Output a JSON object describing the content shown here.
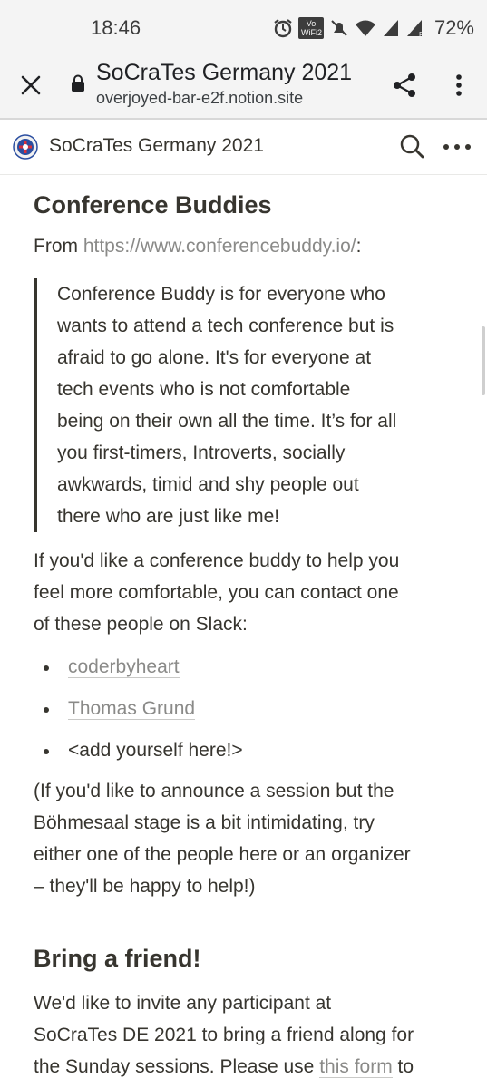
{
  "status_bar": {
    "time": "18:46",
    "wifi_badge": "Vo WiFi2",
    "battery": "72%"
  },
  "browser": {
    "page_title": "SoCraTes Germany 2021",
    "domain": "overjoyed-bar-e2f.notion.site"
  },
  "notion_bar": {
    "title": "SoCraTes Germany 2021"
  },
  "content": {
    "section1_heading": "Conference Buddies",
    "from_prefix": "From ",
    "from_link": "https://www.conferencebuddy.io/",
    "from_suffix": ":",
    "quote_lines": [
      "Conference Buddy is for everyone who",
      "wants to attend a tech conference but is",
      "afraid to go alone. It's for everyone at",
      "tech events who is not comfortable",
      "being on their own all the time. It’s for all",
      "you first-timers, Introverts, socially",
      "awkwards, timid and shy people out",
      "there who are just like me!"
    ],
    "contact_lines": [
      "If you'd like a conference buddy to help you",
      "feel more comfortable, you can contact one",
      "of these people on Slack:"
    ],
    "buddies": [
      "coderbyheart",
      "Thomas Grund"
    ],
    "buddy_add": "<add yourself here!>",
    "note_lines": [
      "(If you'd like to announce a session but the",
      "Böhmesaal stage is a bit intimidating, try",
      "either one of the people here or an organizer",
      "– they'll be happy to help!)"
    ],
    "section2_heading": "Bring a friend!",
    "friend_line1": "We'd like to invite any participant at",
    "friend_line2": "SoCraTes DE 2021 to bring a friend along for",
    "friend_line3_prefix": "the Sunday sessions. Please use ",
    "friend_line3_link": "this form",
    "friend_line3_suffix": " to"
  },
  "icons": {
    "close": "close-icon",
    "lock": "lock-icon",
    "share": "share-icon",
    "more": "more-vertical-icon",
    "search": "search-icon",
    "notion_more": "more-horizontal-icon"
  }
}
